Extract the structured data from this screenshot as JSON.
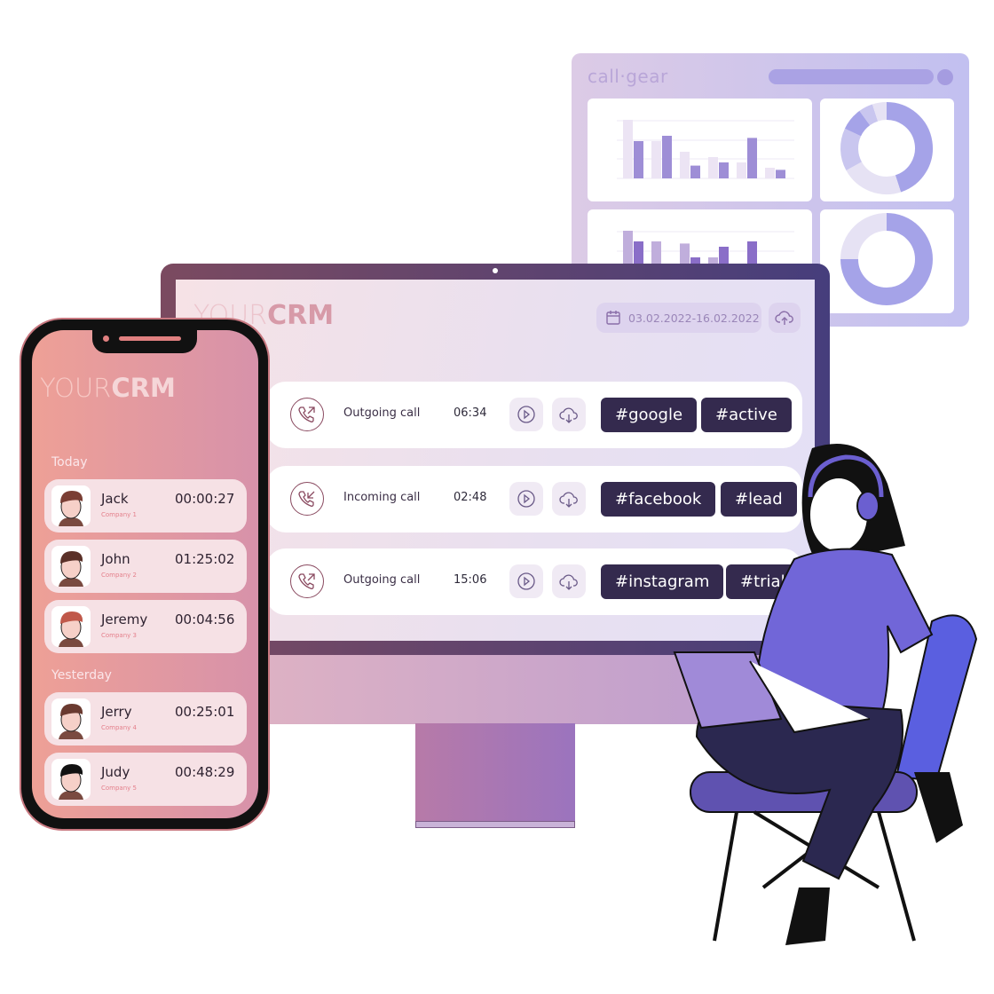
{
  "dashboard": {
    "logo": "call·gear",
    "bars_top": {
      "light": [
        5.5,
        3.5,
        2.5,
        2,
        1.5,
        1
      ],
      "dark": [
        3.5,
        4,
        1.2,
        1.5,
        3.8,
        0.8
      ]
    },
    "bars_bottom": {
      "light": [
        5.5,
        4.5,
        4.3,
        3,
        1,
        0
      ],
      "dark": [
        4.5,
        2,
        3,
        4,
        4.5,
        2
      ]
    },
    "donut_top": [
      45,
      22,
      15,
      8,
      5,
      5
    ],
    "donut_bottom": [
      75,
      25
    ],
    "colors": {
      "primary": "#a5a3e8",
      "light": "#c9c6ef",
      "faint": "#e6e2f4"
    }
  },
  "monitor": {
    "logo_light": "YOUR",
    "logo_bold": "CRM",
    "date_range": "03.02.2022-16.02.2022",
    "calls": [
      {
        "direction": "outgoing",
        "type": "Outgoing call",
        "duration": "06:34",
        "tags": [
          "#google",
          "#active"
        ]
      },
      {
        "direction": "incoming",
        "type": "Incoming call",
        "duration": "02:48",
        "tags": [
          "#facebook",
          "#lead"
        ]
      },
      {
        "direction": "outgoing",
        "type": "Outgoing call",
        "duration": "15:06",
        "tags": [
          "#instagram",
          "#trial"
        ]
      }
    ]
  },
  "phone": {
    "logo_light": "YOUR",
    "logo_bold": "CRM",
    "today_label": "Today",
    "yesterday_label": "Yesterday",
    "contacts": [
      {
        "name": "Jack",
        "company": "Company 1",
        "time": "00:00:27"
      },
      {
        "name": "John",
        "company": "Company 2",
        "time": "01:25:02"
      },
      {
        "name": "Jeremy",
        "company": "Company 3",
        "time": "00:04:56"
      },
      {
        "name": "Jerry",
        "company": "Company 4",
        "time": "00:25:01"
      },
      {
        "name": "Judy",
        "company": "Company 5",
        "time": "00:48:29"
      }
    ]
  }
}
